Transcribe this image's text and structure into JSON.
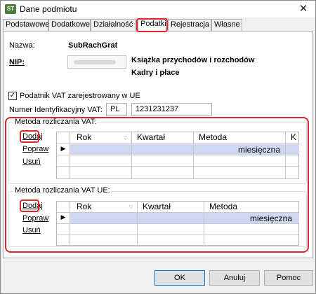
{
  "window": {
    "title": "Dane podmiotu",
    "app_icon_text": "ST",
    "close_glyph": "✕"
  },
  "tabs": [
    {
      "label": "Podstawowe"
    },
    {
      "label": "Dodatkowe"
    },
    {
      "label": "Działalność"
    },
    {
      "label": "Podatki",
      "active": true
    },
    {
      "label": "Rejestracja"
    },
    {
      "label": "Własne"
    }
  ],
  "form": {
    "name_label": "Nazwa:",
    "name_value": "SubRachGrat",
    "nip_label": "NIP:",
    "tax_form_1": "Książka przychodów i rozchodów",
    "tax_form_2": "Kadry i płace",
    "vat_checkbox_label": "Podatnik VAT zarejestrowany w UE",
    "vat_checkbox_checked": true,
    "vat_id_label": "Numer Identyfikacyjny VAT:",
    "vat_country": "PL",
    "vat_number": "1231231237"
  },
  "vat_method": {
    "title": "Metoda rozliczania VAT:",
    "actions": {
      "add": "Dodaj",
      "edit": "Popraw",
      "delete": "Usuń"
    },
    "columns": [
      "Rok",
      "Kwartał",
      "Metoda",
      "K"
    ],
    "rows": [
      {
        "rok": "",
        "kwartal": "",
        "metoda": "miesięczna"
      }
    ]
  },
  "vat_ue_method": {
    "title": "Metoda rozliczania VAT UE:",
    "actions": {
      "add": "Dodaj",
      "edit": "Popraw",
      "delete": "Usuń"
    },
    "columns": [
      "Rok",
      "Kwartał",
      "Metoda"
    ],
    "rows": [
      {
        "rok": "",
        "kwartal": "",
        "metoda": "miesięczna"
      }
    ]
  },
  "footer": {
    "ok": "OK",
    "cancel": "Anuluj",
    "help": "Pomoc"
  },
  "colors": {
    "highlight": "#e0262b",
    "selected_row": "#cfd8f0"
  }
}
